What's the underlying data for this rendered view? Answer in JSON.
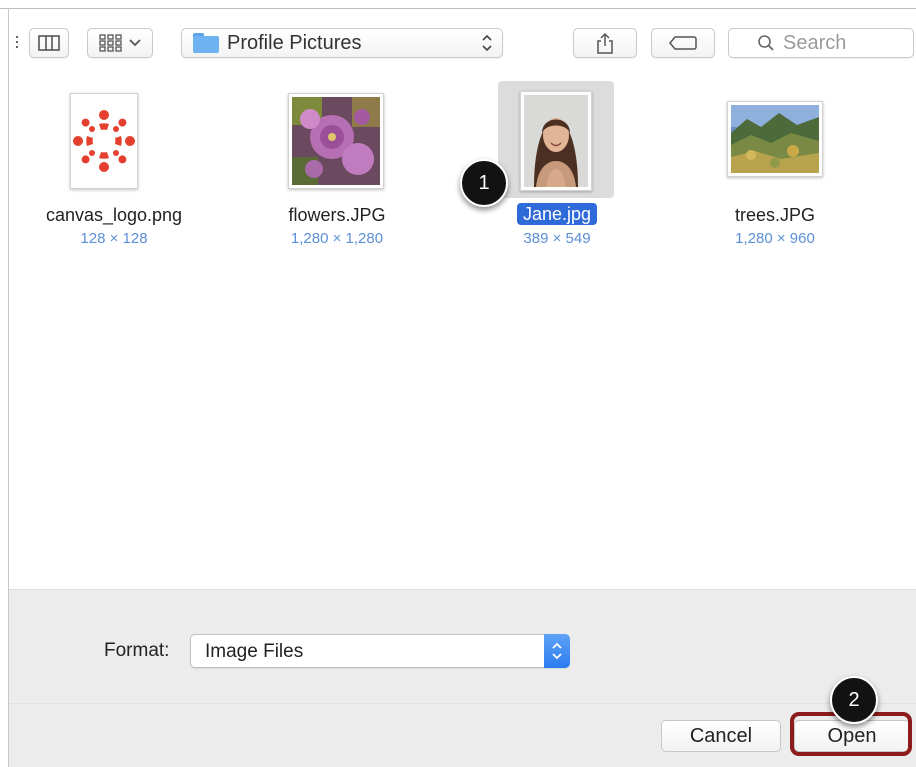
{
  "toolbar": {
    "location": "Profile Pictures",
    "search_placeholder": "Search"
  },
  "files": [
    {
      "name": "canvas_logo.png",
      "dimensions": "128 × 128",
      "selected": false
    },
    {
      "name": "flowers.JPG",
      "dimensions": "1,280 × 1,280",
      "selected": false
    },
    {
      "name": "Jane.jpg",
      "dimensions": "389 × 549",
      "selected": true
    },
    {
      "name": "trees.JPG",
      "dimensions": "1,280 × 960",
      "selected": false
    }
  ],
  "format": {
    "label": "Format:",
    "value": "Image Files"
  },
  "buttons": {
    "cancel": "Cancel",
    "open": "Open"
  },
  "callouts": [
    "1",
    "2"
  ],
  "colors": {
    "selection": "#2f6ad9",
    "dimension_text": "#5b8fd6",
    "highlight_border": "#8c1b1b",
    "canvas_logo": "#e4402f",
    "folder": "#6db3f2"
  },
  "icons": {
    "view_list": "list-view-icon",
    "view_columns": "column-view-icon",
    "view_grid": "icon-grid-icon",
    "share": "share-icon",
    "tag": "tag-icon",
    "search": "search-icon",
    "folder": "folder-icon"
  }
}
